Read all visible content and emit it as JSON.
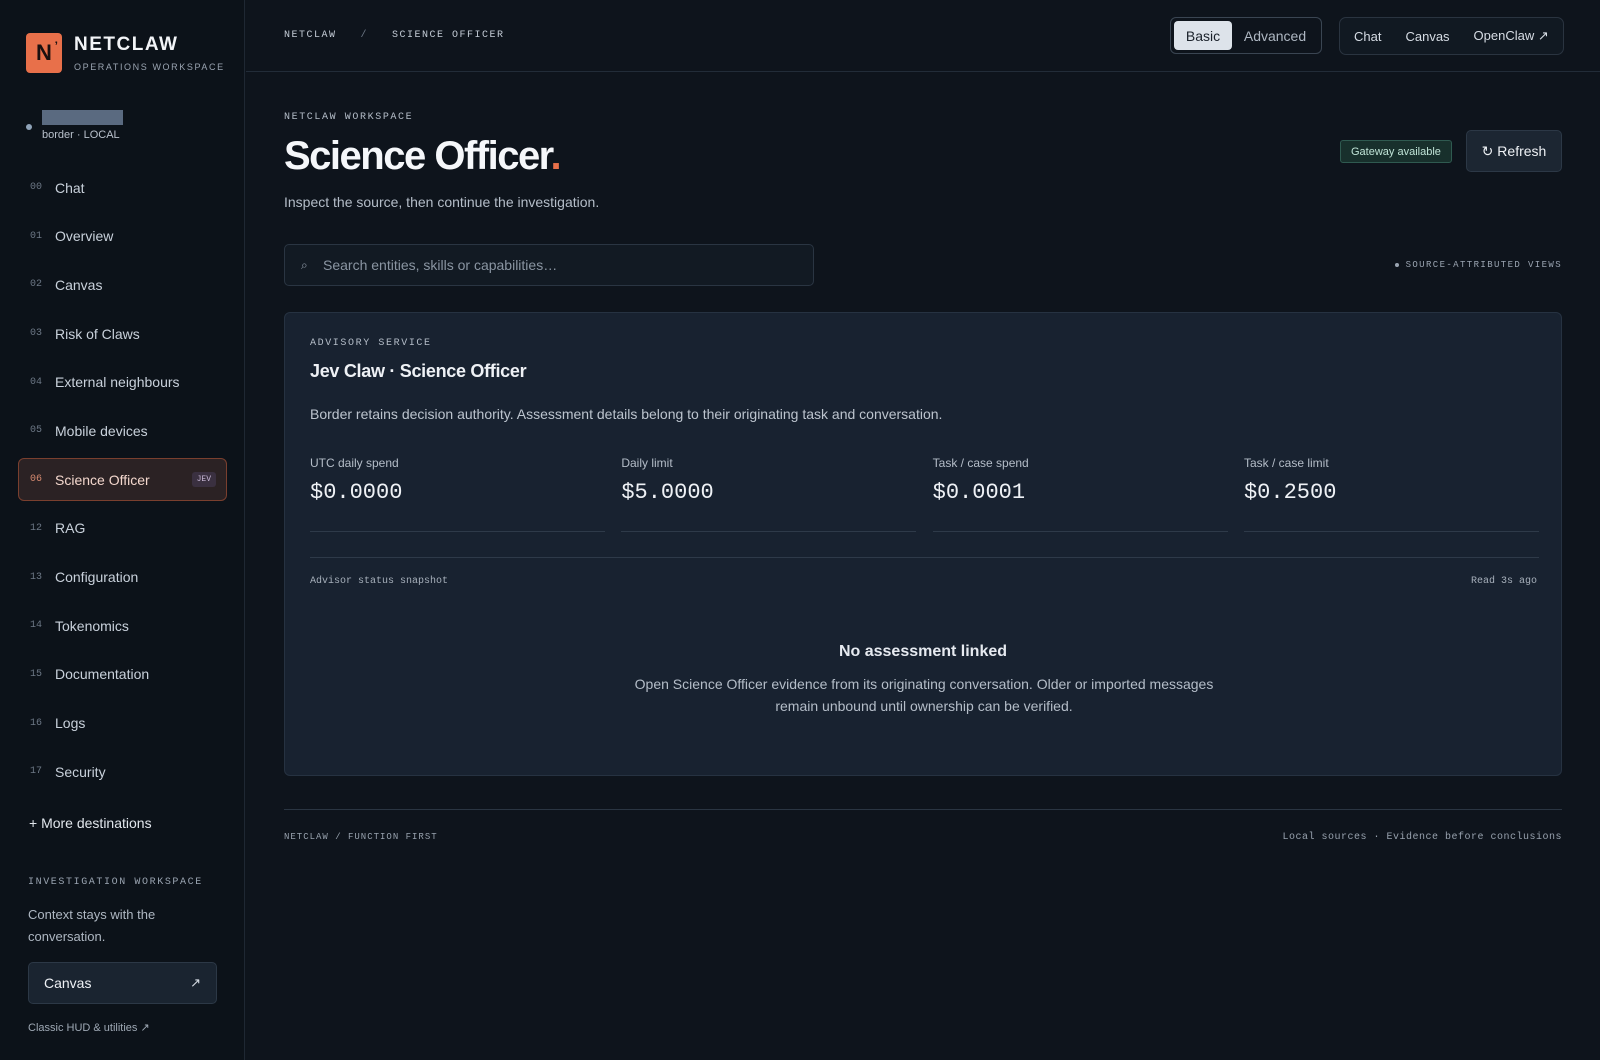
{
  "brand": {
    "logo_letter": "N",
    "logo_mark": "’",
    "name": "NETCLAW",
    "subtitle": "OPERATIONS WORKSPACE",
    "accent": "#e8704a"
  },
  "user": {
    "meta": "border · LOCAL"
  },
  "sidebar": {
    "items": [
      {
        "num": "00",
        "label": "Chat"
      },
      {
        "num": "01",
        "label": "Overview"
      },
      {
        "num": "02",
        "label": "Canvas"
      },
      {
        "num": "03",
        "label": "Risk of Claws"
      },
      {
        "num": "04",
        "label": "External neighbours"
      },
      {
        "num": "05",
        "label": "Mobile devices"
      },
      {
        "num": "06",
        "label": "Science Officer",
        "badge": "JEV",
        "active": true
      },
      {
        "num": "12",
        "label": "RAG"
      },
      {
        "num": "13",
        "label": "Configuration"
      },
      {
        "num": "14",
        "label": "Tokenomics"
      },
      {
        "num": "15",
        "label": "Documentation"
      },
      {
        "num": "16",
        "label": "Logs"
      },
      {
        "num": "17",
        "label": "Security"
      }
    ],
    "more": "+ More destinations",
    "workspace_title": "INVESTIGATION WORKSPACE",
    "workspace_text": "Context stays with the conversation.",
    "canvas_button": "Canvas",
    "canvas_arrow": "↗",
    "classic_link": "Classic HUD & utilities ↗"
  },
  "topbar": {
    "breadcrumb": [
      "NETCLAW",
      "SCIENCE OFFICER"
    ],
    "breadcrumb_sep": "/",
    "mode": {
      "basic": "Basic",
      "advanced": "Advanced",
      "selected": "Basic"
    },
    "links": [
      "Chat",
      "Canvas",
      "OpenClaw ↗"
    ]
  },
  "main": {
    "eyebrow": "NETCLAW WORKSPACE",
    "title": "Science Officer",
    "title_dot": ".",
    "subtitle": "Inspect the source, then continue the investigation.",
    "gateway": "Gateway available",
    "refresh": "↻ Refresh",
    "search_placeholder": "Search entities, skills or capabilities…",
    "search_icon": "⌕",
    "source_tag": "SOURCE-ATTRIBUTED VIEWS"
  },
  "card": {
    "eyebrow": "ADVISORY SERVICE",
    "title": "Jev Claw · Science Officer",
    "description": "Border retains decision authority. Assessment details belong to their originating task and conversation.",
    "stats": [
      {
        "label": "UTC daily spend",
        "value": "$0.0000"
      },
      {
        "label": "Daily limit",
        "value": "$5.0000"
      },
      {
        "label": "Task / case spend",
        "value": "$0.0001"
      },
      {
        "label": "Task / case limit",
        "value": "$0.2500"
      }
    ],
    "snapshot_label": "Advisor status snapshot",
    "snapshot_read": "Read 3s ago",
    "empty_title": "No assessment linked",
    "empty_text": "Open Science Officer evidence from its originating conversation. Older or imported messages remain unbound until ownership can be verified."
  },
  "footer": {
    "left": "NETCLAW / FUNCTION FIRST",
    "right": "Local sources · Evidence before conclusions"
  }
}
